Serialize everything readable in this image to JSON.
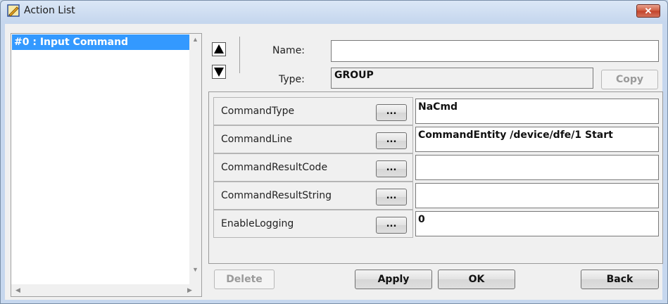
{
  "window": {
    "title": "Action List",
    "close_symbol": "✕"
  },
  "list": {
    "items": [
      {
        "label": "#0 : Input Command",
        "selected": true
      }
    ]
  },
  "form": {
    "name_label": "Name:",
    "name_value": "",
    "type_label": "Type:",
    "type_value": "GROUP",
    "copy_label": "Copy"
  },
  "properties": [
    {
      "name": "CommandType",
      "button": "...",
      "value": "NaCmd"
    },
    {
      "name": "CommandLine",
      "button": "...",
      "value": "CommandEntity /device/dfe/1 Start"
    },
    {
      "name": "CommandResultCode",
      "button": "...",
      "value": ""
    },
    {
      "name": "CommandResultString",
      "button": "...",
      "value": ""
    },
    {
      "name": "EnableLogging",
      "button": "...",
      "value": "0"
    }
  ],
  "buttons": {
    "delete": "Delete",
    "apply": "Apply",
    "ok": "OK",
    "back": "Back"
  },
  "icons": {
    "app": "pencil-ruler-icon",
    "up": "up-triangle-icon",
    "down": "down-triangle-icon"
  }
}
